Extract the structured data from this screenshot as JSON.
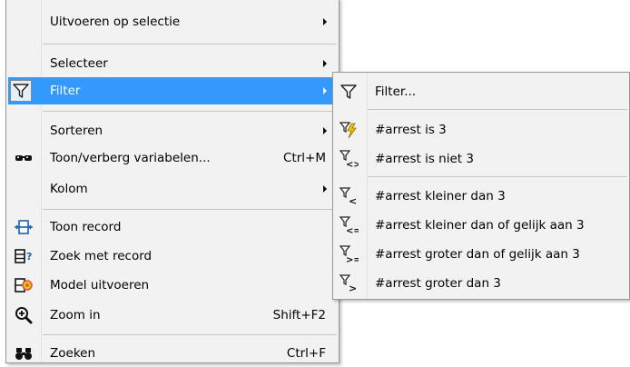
{
  "main_menu": {
    "run_on_selection": "Uitvoeren op selectie",
    "select": "Selecteer",
    "filter": "Filter",
    "sort": "Sorteren",
    "show_hide_variables": "Toon/verberg variabelen...",
    "show_hide_shortcut": "Ctrl+M",
    "column": "Kolom",
    "show_record": "Toon record",
    "find_with_record": "Zoek met record",
    "run_model": "Model uitvoeren",
    "zoom_in": "Zoom in",
    "zoom_in_shortcut": "Shift+F2",
    "find": "Zoeken",
    "find_shortcut": "Ctrl+F"
  },
  "filter_submenu": {
    "filter_dialog": "Filter...",
    "is": "#arrest is 3",
    "is_not": "#arrest is niet 3",
    "less_than": "#arrest kleiner dan 3",
    "less_equal": "#arrest kleiner dan of gelijk aan 3",
    "greater_equal": "#arrest groter dan of gelijk aan 3",
    "greater_than": "#arrest groter dan 3"
  },
  "colors": {
    "highlight": "#3399ff",
    "menu_bg": "#f2f2f2",
    "icon_blue": "#1a5fb4",
    "icon_yellow": "#f5c400"
  }
}
